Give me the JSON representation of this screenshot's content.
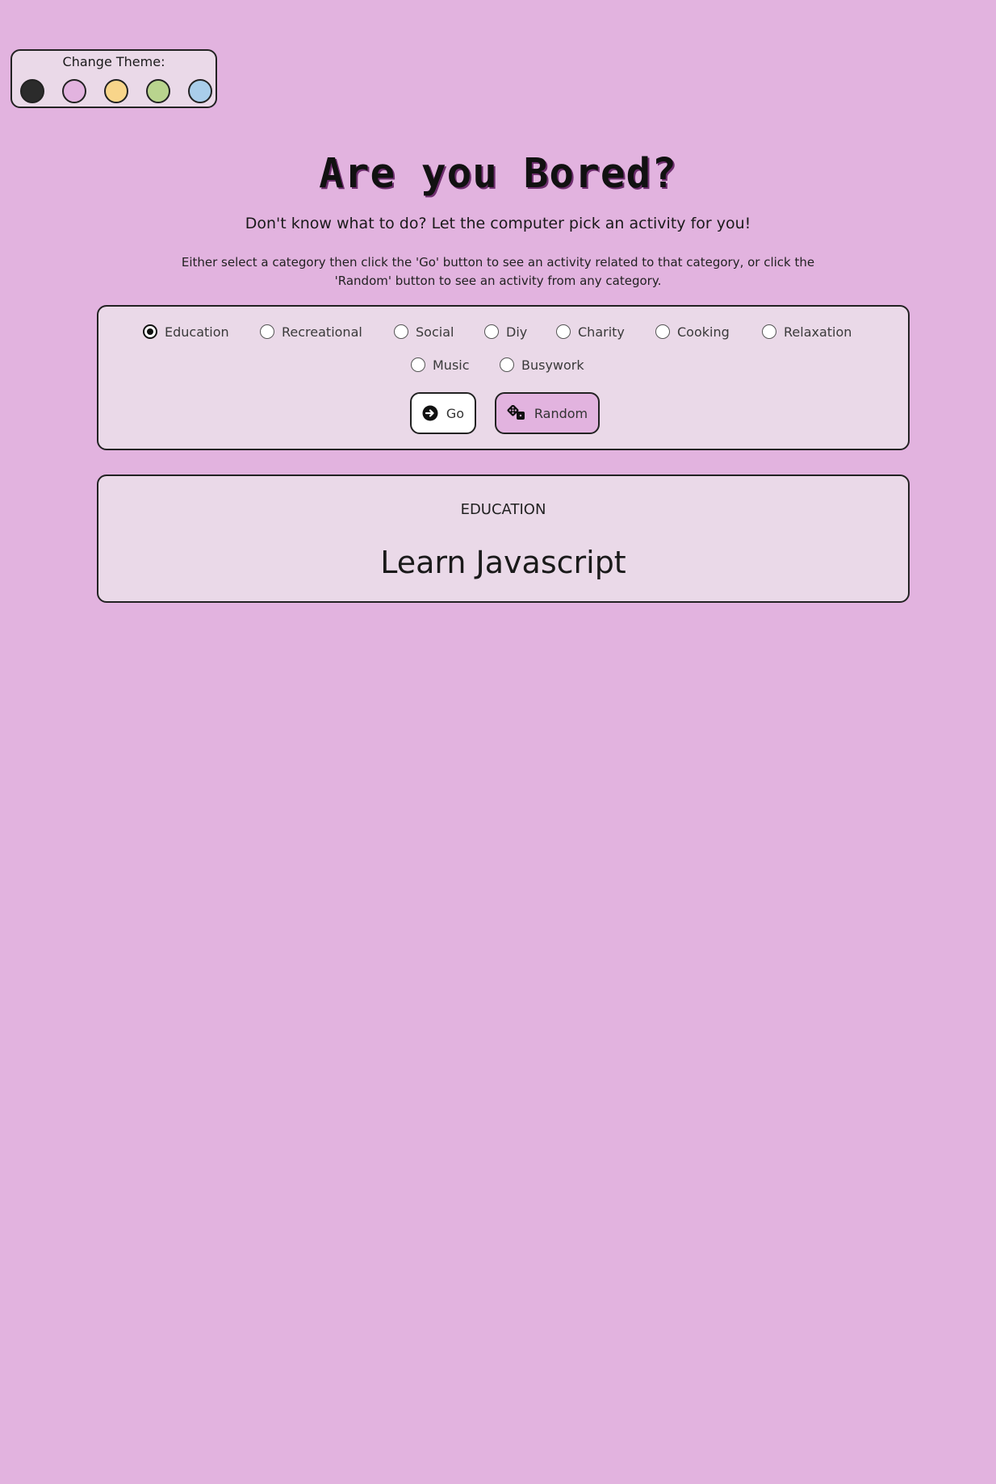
{
  "theme": {
    "label": "Change Theme:",
    "swatches": [
      {
        "name": "dark",
        "color": "#2b2b2b"
      },
      {
        "name": "pink",
        "color": "#e2b3df"
      },
      {
        "name": "yellow",
        "color": "#f8d58a"
      },
      {
        "name": "green",
        "color": "#b9d48e"
      },
      {
        "name": "blue",
        "color": "#a9cdea"
      }
    ]
  },
  "header": {
    "title": "Are you Bored?",
    "subtitle": "Don't know what to do? Let the computer pick an activity for you!",
    "instructions": "Either select a category then click the 'Go' button to see an activity related to that category, or click the 'Random' button to see an activity from any category."
  },
  "categories": {
    "selected": "Education",
    "items": [
      {
        "label": "Education",
        "checked": true
      },
      {
        "label": "Recreational",
        "checked": false
      },
      {
        "label": "Social",
        "checked": false
      },
      {
        "label": "Diy",
        "checked": false
      },
      {
        "label": "Charity",
        "checked": false
      },
      {
        "label": "Cooking",
        "checked": false
      },
      {
        "label": "Relaxation",
        "checked": false
      },
      {
        "label": "Music",
        "checked": false
      },
      {
        "label": "Busywork",
        "checked": false
      }
    ]
  },
  "buttons": {
    "go_label": "Go",
    "go_icon": "arrow-circle-right-icon",
    "random_label": "Random",
    "random_icon": "dice-icon"
  },
  "result": {
    "category": "EDUCATION",
    "activity": "Learn Javascript"
  }
}
